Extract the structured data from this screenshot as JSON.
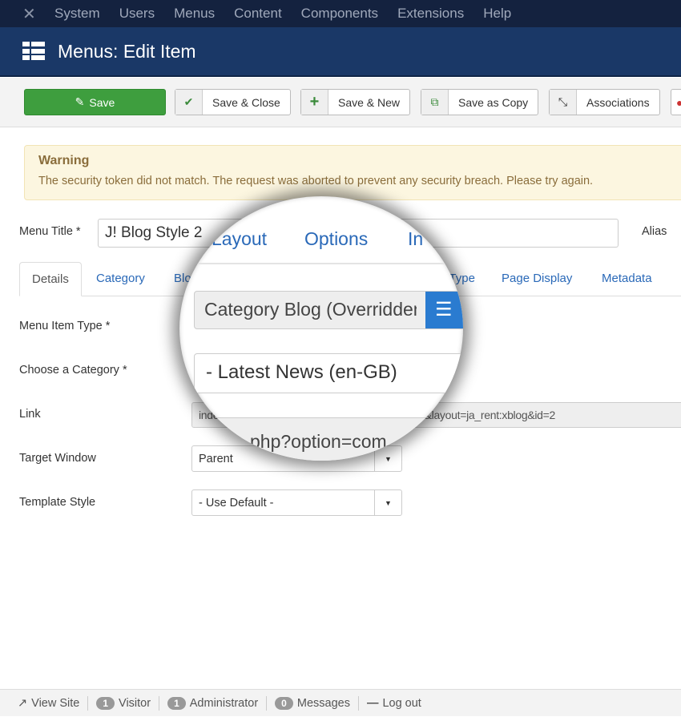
{
  "nav": {
    "items": [
      "System",
      "Users",
      "Menus",
      "Content",
      "Components",
      "Extensions",
      "Help"
    ]
  },
  "header": {
    "title": "Menus: Edit Item"
  },
  "toolbar": {
    "save": "Save",
    "save_close": "Save & Close",
    "save_new": "Save & New",
    "save_copy": "Save as Copy",
    "associations": "Associations"
  },
  "warning": {
    "title": "Warning",
    "message": "The security token did not match. The request was aborted to prevent any security breach. Please try again."
  },
  "form": {
    "menu_title_label": "Menu Title *",
    "menu_title_value": "J! Blog Style 2",
    "alias_label": "Alias",
    "tabs": [
      "Details",
      "Category",
      "Blog Layout",
      "Link Type",
      "Page Display",
      "Metadata"
    ],
    "menu_item_type_label": "Menu Item Type *",
    "choose_category_label": "Choose a Category *",
    "link_label": "Link",
    "link_value": "index.php?option=com_content&view=category&layout=ja_rent:xblog&id=2",
    "target_window_label": "Target Window",
    "target_window_value": "Parent",
    "template_style_label": "Template Style",
    "template_style_value": "- Use Default -"
  },
  "magnifier": {
    "tab_layout": "Layout",
    "tab_options": "Options",
    "tab_more": "In",
    "menu_item_type_value": "Category Blog (Overridden)",
    "category_value": "- Latest News (en-GB)",
    "link_fragment": "php?option=com"
  },
  "footer": {
    "view_site": "View Site",
    "visitor_count": "1",
    "visitor": "Visitor",
    "admin_count": "1",
    "admin": "Administrator",
    "messages_count": "0",
    "messages": "Messages",
    "logout": "Log out"
  }
}
